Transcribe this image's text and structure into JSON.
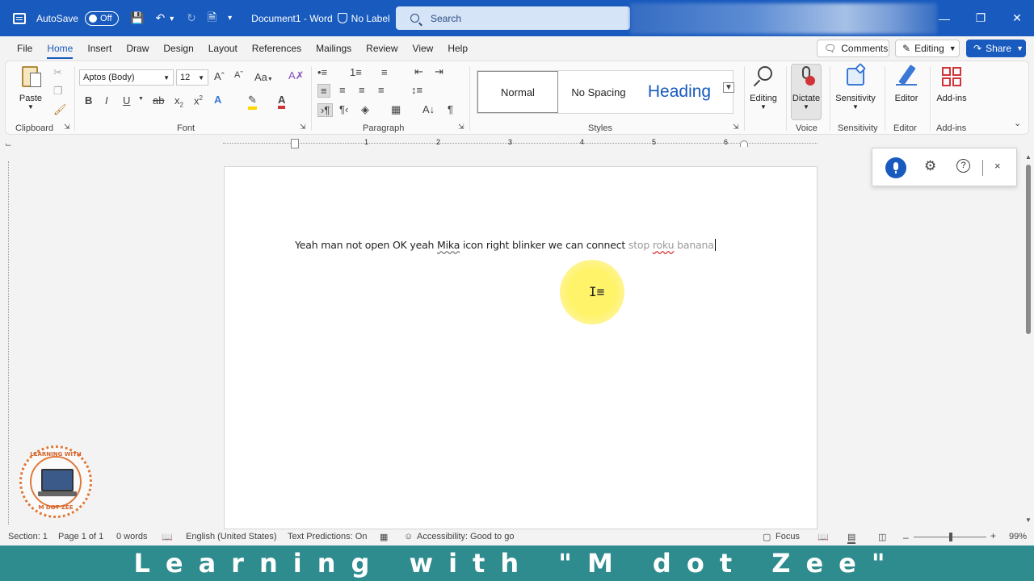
{
  "titlebar": {
    "autosave_label": "AutoSave",
    "autosave_state": "Off",
    "document_name": "Document1  -  Word",
    "sensitivity_label": "No Label",
    "search_placeholder": "Search"
  },
  "menu": {
    "items": [
      "File",
      "Home",
      "Insert",
      "Draw",
      "Design",
      "Layout",
      "References",
      "Mailings",
      "Review",
      "View",
      "Help"
    ],
    "active": "Home",
    "comments_label": "Comments",
    "editing_label": "Editing",
    "share_label": "Share"
  },
  "ribbon": {
    "clipboard": {
      "paste_label": "Paste",
      "group_label": "Clipboard"
    },
    "font": {
      "font_name": "Aptos (Body)",
      "font_size": "12",
      "group_label": "Font"
    },
    "paragraph": {
      "group_label": "Paragraph"
    },
    "styles": {
      "normal": "Normal",
      "no_spacing": "No Spacing",
      "heading": "Heading",
      "group_label": "Styles"
    },
    "editing": {
      "label": "Editing"
    },
    "voice": {
      "dictate_label": "Dictate",
      "group_label": "Voice"
    },
    "sensitivity": {
      "label": "Sensitivity",
      "group_label": "Sensitivity"
    },
    "editor": {
      "label": "Editor",
      "group_label": "Editor"
    },
    "addins": {
      "label": "Add-ins",
      "group_label": "Add-ins"
    }
  },
  "ruler": {
    "marks": [
      "1",
      "2",
      "3",
      "4",
      "5",
      "6"
    ]
  },
  "document": {
    "text_committed": "Yeah man not open OK yeah ",
    "text_mika": "Mika",
    "text_committed_2": " icon right blinker we can connect ",
    "text_pending_1": "stop ",
    "text_pending_roku": "roku",
    "text_pending_2": " banana"
  },
  "statusbar": {
    "section": "Section: 1",
    "page": "Page 1 of 1",
    "words": "0 words",
    "language": "English (United States)",
    "text_predictions": "Text Predictions: On",
    "accessibility": "Accessibility: Good to go",
    "focus": "Focus",
    "zoom": "99%"
  },
  "banner": {
    "text": "Learning with \"M dot Zee\""
  },
  "watermark": {
    "top_text": "LEARNING WITH",
    "bottom_text": "M DOT ZEE"
  },
  "colors": {
    "word_blue": "#185abd",
    "banner_teal": "#2e8b8e",
    "dictate_blue": "#185abd"
  }
}
